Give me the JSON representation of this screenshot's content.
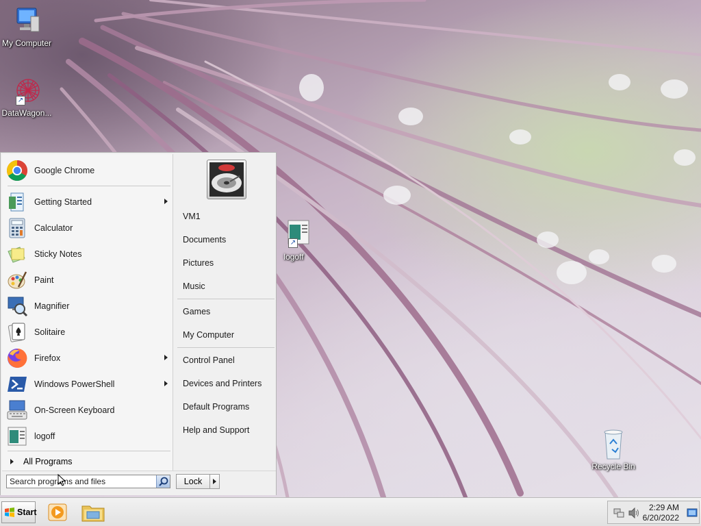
{
  "desktop": {
    "icons": [
      {
        "label": "My Computer"
      },
      {
        "label": "DataWagon..."
      },
      {
        "label": "logoff"
      },
      {
        "label": "Recycle Bin"
      }
    ]
  },
  "start_menu": {
    "pinned": [
      {
        "label": "Google Chrome"
      }
    ],
    "programs": [
      {
        "label": "Getting Started",
        "submenu": true
      },
      {
        "label": "Calculator",
        "submenu": false
      },
      {
        "label": "Sticky Notes",
        "submenu": false
      },
      {
        "label": "Paint",
        "submenu": false
      },
      {
        "label": "Magnifier",
        "submenu": false
      },
      {
        "label": "Solitaire",
        "submenu": false
      },
      {
        "label": "Firefox",
        "submenu": true
      },
      {
        "label": "Windows PowerShell",
        "submenu": true
      },
      {
        "label": "On-Screen Keyboard",
        "submenu": false
      },
      {
        "label": "logoff",
        "submenu": false
      }
    ],
    "all_programs": "All Programs",
    "search_placeholder": "Search programs and files",
    "right_links": [
      {
        "label": "VM1"
      },
      {
        "label": "Documents"
      },
      {
        "label": "Pictures"
      },
      {
        "label": "Music"
      },
      {
        "label": "Games"
      },
      {
        "label": "My Computer"
      },
      {
        "label": "Control Panel"
      },
      {
        "label": "Devices and Printers"
      },
      {
        "label": "Default Programs"
      },
      {
        "label": "Help and Support"
      }
    ],
    "lock_label": "Lock"
  },
  "taskbar": {
    "start_label": "Start",
    "pinned_icons": [
      "media-player-icon",
      "file-explorer-icon"
    ],
    "clock": {
      "time": "2:29 AM",
      "date": "6/20/2022"
    }
  },
  "colors": {
    "menu_bg": "#f0f0f0",
    "taskbar_bg": "#e6e6e6",
    "accent_blue": "#1a4fa6"
  }
}
